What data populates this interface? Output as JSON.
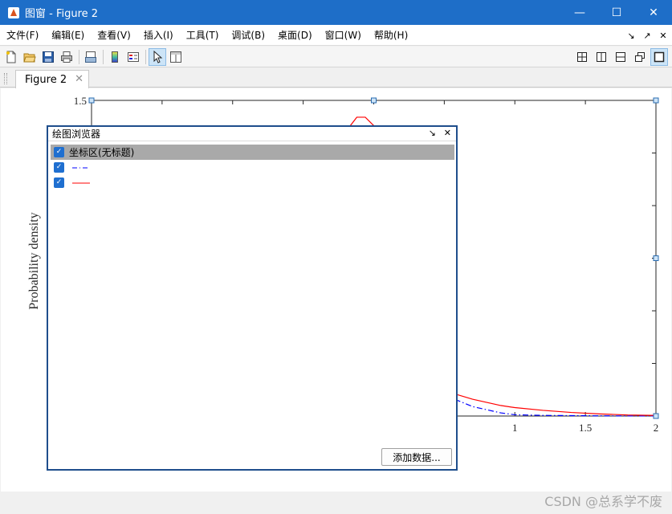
{
  "window": {
    "title": "图窗 - Figure 2",
    "minimize_glyph": "—",
    "maximize_glyph": "☐",
    "close_glyph": "✕"
  },
  "menubar": {
    "items": [
      "文件(F)",
      "编辑(E)",
      "查看(V)",
      "插入(I)",
      "工具(T)",
      "调试(B)",
      "桌面(D)",
      "窗口(W)",
      "帮助(H)"
    ],
    "right_icons": [
      "↘",
      "↗",
      "✕"
    ]
  },
  "toolbar": {
    "icons": [
      "new-figure-icon",
      "open-file-icon",
      "save-icon",
      "print-icon",
      "print-preview-icon",
      "insert-colorbar-icon",
      "insert-legend-icon",
      "edit-plot-icon",
      "property-inspector-icon"
    ],
    "layout_icons": [
      "tile-grid-icon",
      "split-columns-icon",
      "split-rows-icon",
      "float-icon",
      "maximize-icon"
    ]
  },
  "tab": {
    "label": "Figure 2",
    "close_glyph": "✕"
  },
  "chart_data": {
    "type": "line",
    "title": "",
    "xlabel": "",
    "ylabel": "Probability density",
    "xlim": [
      -2,
      2
    ],
    "ylim": [
      0,
      1.5
    ],
    "x_ticks": [
      "1",
      "1.5",
      "2"
    ],
    "y_ticks": [
      "1.5"
    ],
    "series": [
      {
        "style": "dash-dot",
        "color": "#0000ff",
        "x": [
          0.5,
          0.7,
          0.9,
          1.0,
          1.2,
          1.4,
          1.6,
          1.8,
          2.0
        ],
        "y": [
          0.1,
          0.045,
          0.015,
          0.006,
          0.003,
          0.002,
          0.001,
          0.0005,
          0.0003
        ]
      },
      {
        "style": "solid",
        "color": "#ff0000",
        "x": [
          -0.2,
          -0.12,
          -0.06,
          0.0,
          0.5,
          0.7,
          0.9,
          1.0,
          1.2,
          1.4,
          1.6,
          1.8,
          2.0
        ],
        "y": [
          1.35,
          1.42,
          1.42,
          1.38,
          0.12,
          0.08,
          0.05,
          0.04,
          0.027,
          0.017,
          0.01,
          0.005,
          0.003
        ]
      }
    ]
  },
  "plot_browser": {
    "title": "绘图浏览器",
    "dock_glyph": "↘",
    "close_glyph": "✕",
    "tree": [
      {
        "label": "坐标区(无标题)",
        "checked_glyph": "✓",
        "selected": true
      },
      {
        "label": "",
        "checked_glyph": "✓",
        "line_color": "#0000ff",
        "line_style": "dash-dot"
      },
      {
        "label": "",
        "checked_glyph": "✓",
        "line_color": "#ff0000",
        "line_style": "solid"
      }
    ],
    "add_data_label": "添加数据..."
  },
  "watermark": "CSDN @总系学不废"
}
